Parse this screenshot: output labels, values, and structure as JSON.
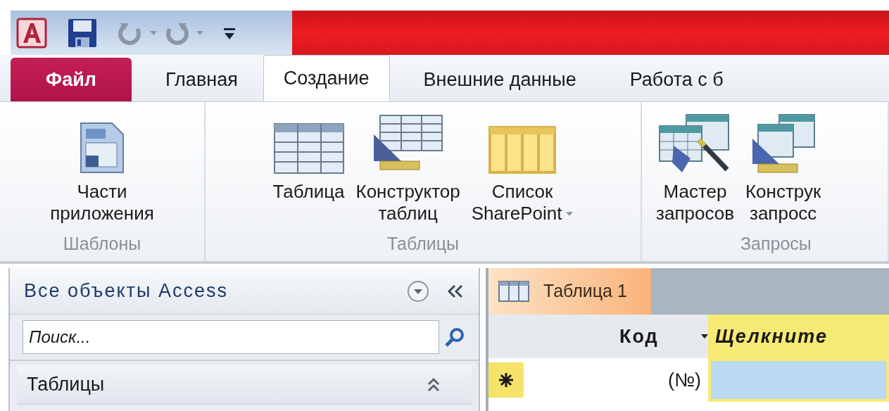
{
  "ribbon_tabs": [
    {
      "label": "Файл",
      "kind": "file",
      "selected": false
    },
    {
      "label": "Главная",
      "kind": "tab",
      "selected": false
    },
    {
      "label": "Создание",
      "kind": "tab",
      "selected": true
    },
    {
      "label": "Внешние данные",
      "kind": "tab",
      "selected": false
    },
    {
      "label": "Работа с б",
      "kind": "tab",
      "selected": false
    }
  ],
  "ribbon_groups": [
    {
      "label": "Шаблоны",
      "buttons": [
        {
          "kind": "parts",
          "lines": [
            "Части",
            "приложения"
          ],
          "dropdown": false
        }
      ]
    },
    {
      "label": "Таблицы",
      "buttons": [
        {
          "kind": "table",
          "lines": [
            "Таблица"
          ],
          "dropdown": false
        },
        {
          "kind": "table-design",
          "lines": [
            "Конструктор",
            "таблиц"
          ],
          "dropdown": false
        },
        {
          "kind": "list",
          "lines": [
            "Список",
            "SharePoint"
          ],
          "dropdown": true
        }
      ]
    },
    {
      "label": "Запросы",
      "buttons": [
        {
          "kind": "query-wizard",
          "lines": [
            "Мастер",
            "запросов"
          ],
          "dropdown": false
        },
        {
          "kind": "query-design",
          "lines": [
            "Конструк",
            "запросс"
          ],
          "dropdown": false
        }
      ]
    }
  ],
  "navigation_pane": {
    "title": "Все объекты Access",
    "search": {
      "placeholder": "Поиск..."
    },
    "groups": [
      {
        "label": "Таблицы",
        "expanded": true
      }
    ]
  },
  "document_tabs": [
    {
      "label": "Таблица 1",
      "selected": true
    }
  ],
  "datasheet": {
    "columns": [
      {
        "label": "Код",
        "selected": false
      },
      {
        "label": "Щелкните",
        "selected": true
      }
    ],
    "new_row": {
      "id_placeholder": "(№)"
    }
  }
}
